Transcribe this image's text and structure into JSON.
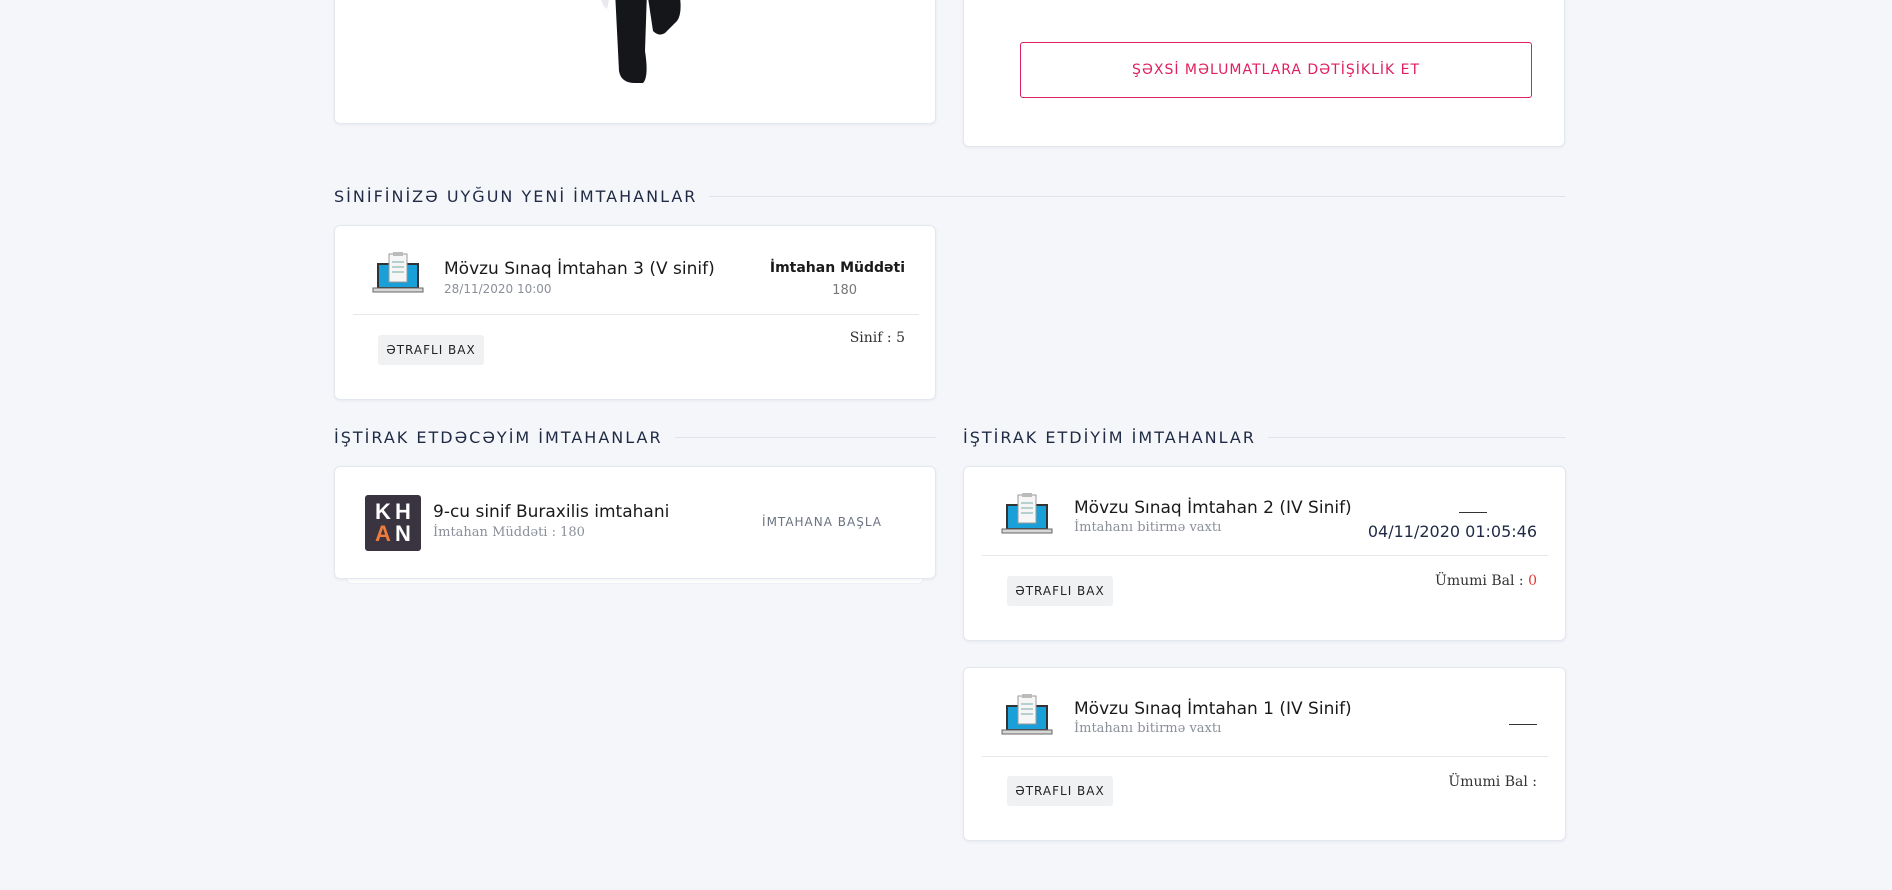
{
  "profile": {
    "edit_button_label": "ŞƏXSİ MƏLUMATLARA DƏTİŞİKLİK ET"
  },
  "sections": {
    "new_exams_title": "SİNİFİNİZƏ UYĞUN YENİ İMTAHANLAR",
    "will_attend_title": "İŞTİRAK ETDƏCƏYİM İMTAHANLAR",
    "attended_title": "İŞTİRAK ETDİYİM İMTAHANLAR"
  },
  "new_exam": {
    "title": "Mövzu Sınaq İmtahan 3 (V sinif)",
    "date": "28/11/2020 10:00",
    "duration_label": "İmtahan Müddəti",
    "duration_value": "180",
    "details_label": "ƏTRAFLI BAX",
    "class_text": "Sinif : 5"
  },
  "upcoming_exam": {
    "logo_letters": [
      "K",
      "H",
      "A",
      "N"
    ],
    "title": "9-cu sinif Buraxilis imtahani",
    "duration_text": "İmtahan Müddəti : 180",
    "start_label": "İMTAHANA BAŞLA"
  },
  "attended_exams": [
    {
      "title": "Mövzu Sınaq İmtahan 2 (IV Sinif)",
      "subtitle": "İmtahanı bitirmə vaxtı",
      "end_time": "04/11/2020 01:05:46",
      "details_label": "ƏTRAFLI BAX",
      "score_label": "Ümumi Bal :",
      "score_value": "0"
    },
    {
      "title": "Mövzu Sınaq İmtahan 1 (IV Sinif)",
      "subtitle": "İmtahanı bitirmə vaxtı",
      "end_time": "",
      "details_label": "ƏTRAFLI BAX",
      "score_label": "Ümumi Bal :",
      "score_value": ""
    }
  ],
  "colors": {
    "accent": "#e0205e",
    "score_red": "#e53935",
    "laptop_screen": "#1aa0d8"
  }
}
